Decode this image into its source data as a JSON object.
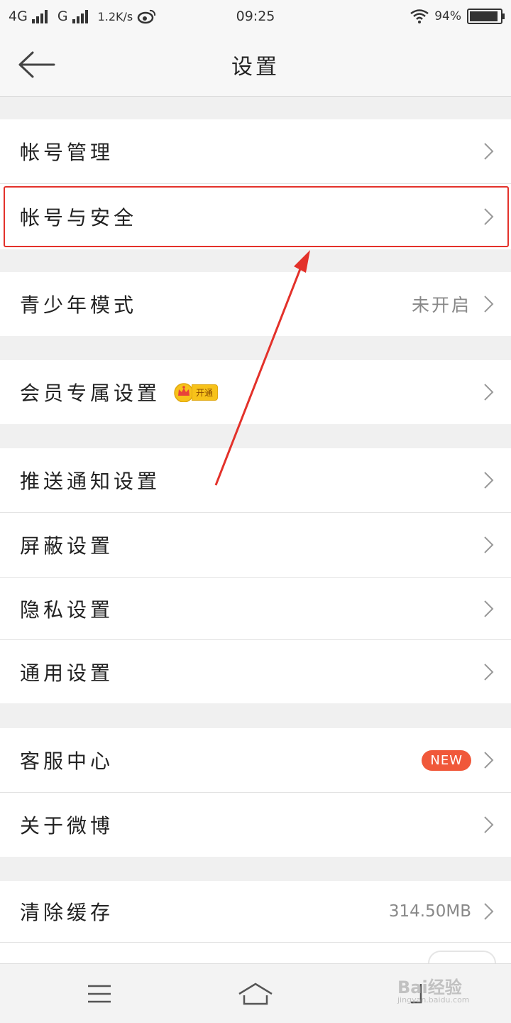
{
  "status": {
    "net1": "4G",
    "net2": "G",
    "speed": "1.2K/s",
    "time": "09:25",
    "battery": "94%",
    "battery_level": 0.94
  },
  "header": {
    "title": "设置"
  },
  "rows": {
    "account_manage": "帐号管理",
    "account_security": "帐号与安全",
    "teen_mode": "青少年模式",
    "teen_mode_value": "未开启",
    "vip_settings": "会员专属设置",
    "vip_badge": "开通",
    "push": "推送通知设置",
    "block": "屏蔽设置",
    "privacy": "隐私设置",
    "general": "通用设置",
    "service": "客服中心",
    "service_badge": "NEW",
    "about": "关于微博",
    "cache": "清除缓存",
    "cache_value": "314.50MB"
  },
  "watermark": {
    "text": "Bai经验",
    "sub": "jingyan.baidu.com"
  },
  "colors": {
    "highlight": "#e3312a",
    "new_badge": "#f0583a",
    "vip_gold": "#f7c21a"
  }
}
